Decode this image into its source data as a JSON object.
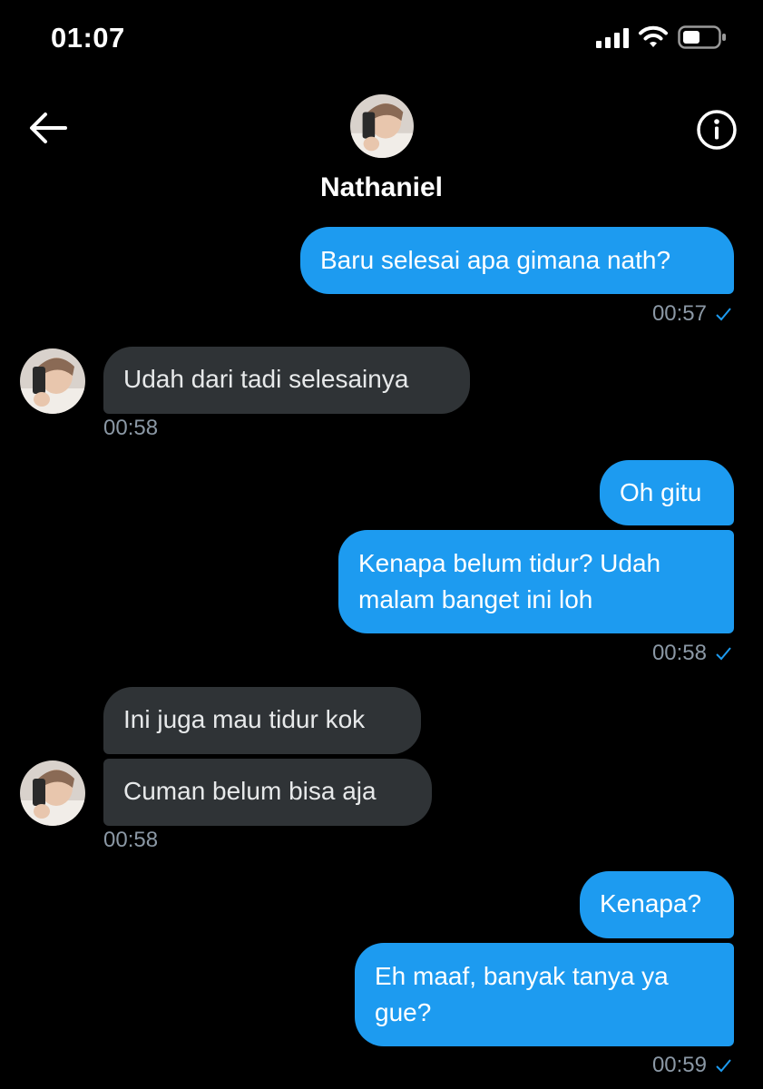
{
  "status_bar": {
    "time": "01:07"
  },
  "header": {
    "contact_name": "Nathaniel"
  },
  "colors": {
    "sent_bubble": "#1d9bf0",
    "received_bubble": "#2f3336",
    "timestamp": "#8b98a5",
    "background": "#000000"
  },
  "messages": {
    "m1": {
      "text": "Baru selesai apa gimana nath?",
      "time": "00:57"
    },
    "m2": {
      "text": "Udah dari tadi selesainya",
      "time": "00:58"
    },
    "m3": {
      "text": "Oh gitu"
    },
    "m4": {
      "line1": "Kenapa belum tidur? Udah",
      "line2": "malam banget ini loh",
      "time": "00:58"
    },
    "m5": {
      "text": "Ini juga mau tidur kok"
    },
    "m6": {
      "text": "Cuman belum bisa aja",
      "time": "00:58"
    },
    "m7": {
      "text": "Kenapa?"
    },
    "m8": {
      "line1": "Eh maaf, banyak tanya ya",
      "line2": "gue?",
      "time": "00:59"
    }
  }
}
